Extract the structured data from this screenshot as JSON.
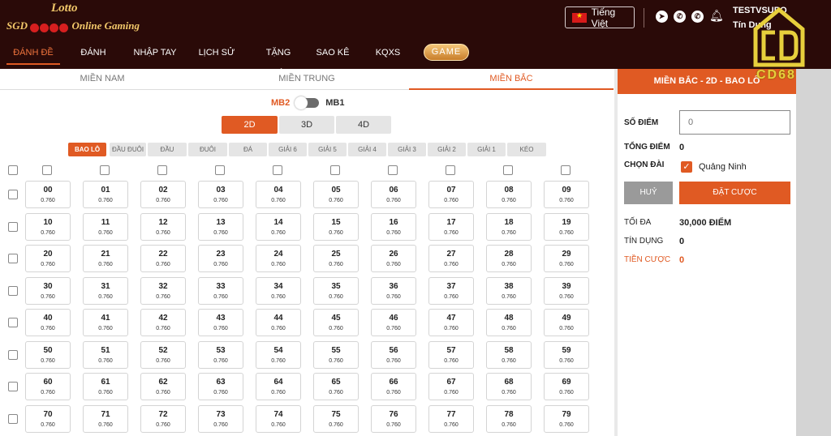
{
  "header": {
    "logo_top": "Lotto",
    "logo_bottom_left": "SGD",
    "logo_bottom_right": "Online Gaming",
    "language": "Tiếng Việt",
    "username": "TESTVSUPO",
    "credit_label": "Tín Dụng",
    "brand_watermark": "CD68",
    "colors": {
      "bg": "#2a0a08",
      "accent": "#e05a23"
    }
  },
  "nav": {
    "items": [
      "ĐÁNH ĐỀ",
      "ĐÁNH NHANH",
      "NHẬP TAY",
      "LỊCH SỬ CƯỢC",
      "TẶNG CÒ",
      "SAO KÊ",
      "KQXS"
    ],
    "game_label": "GAME"
  },
  "region_tabs": [
    "MIỀN NAM",
    "MIỀN TRUNG",
    "MIỀN BẮC"
  ],
  "mb_toggle": {
    "left": "MB2",
    "right": "MB1"
  },
  "type_buttons": [
    "2D",
    "3D",
    "4D"
  ],
  "subtabs": [
    "BAO LÔ",
    "ĐẦU ĐUÔI",
    "ĐẦU",
    "ĐUÔI",
    "ĐÁ",
    "GIẢI 6",
    "GIẢI 5",
    "GIẢI 4",
    "GIẢI 3",
    "GIẢI 2",
    "GIẢI 1",
    "KÉO"
  ],
  "grid": {
    "odds": "0.760",
    "rows": [
      [
        "00",
        "01",
        "02",
        "03",
        "04",
        "05",
        "06",
        "07",
        "08",
        "09"
      ],
      [
        "10",
        "11",
        "12",
        "13",
        "14",
        "15",
        "16",
        "17",
        "18",
        "19"
      ],
      [
        "20",
        "21",
        "22",
        "23",
        "24",
        "25",
        "26",
        "27",
        "28",
        "29"
      ],
      [
        "30",
        "31",
        "32",
        "33",
        "34",
        "35",
        "36",
        "37",
        "38",
        "39"
      ],
      [
        "40",
        "41",
        "42",
        "43",
        "44",
        "45",
        "46",
        "47",
        "48",
        "49"
      ],
      [
        "50",
        "51",
        "52",
        "53",
        "54",
        "55",
        "56",
        "57",
        "58",
        "59"
      ],
      [
        "60",
        "61",
        "62",
        "63",
        "64",
        "65",
        "66",
        "67",
        "68",
        "69"
      ],
      [
        "70",
        "71",
        "72",
        "73",
        "74",
        "75",
        "76",
        "77",
        "78",
        "79"
      ]
    ]
  },
  "side": {
    "title": "MIỀN BẮC - 2D - BAO LÔ",
    "points_label": "SỐ ĐIỂM",
    "points_placeholder": "0",
    "total_label": "TỔNG ĐIỂM",
    "total_value": "0",
    "station_label": "CHỌN ĐÀI",
    "station_name": "Quảng Ninh",
    "cancel_label": "HUỶ",
    "bet_label": "ĐẶT CƯỢC",
    "max_label": "TỐI ĐA",
    "max_value": "30,000 ĐIỂM",
    "credit_label": "TÍN DỤNG",
    "credit_value": "0",
    "bet_money_label": "TIỀN CƯỢC",
    "bet_money_value": "0"
  }
}
